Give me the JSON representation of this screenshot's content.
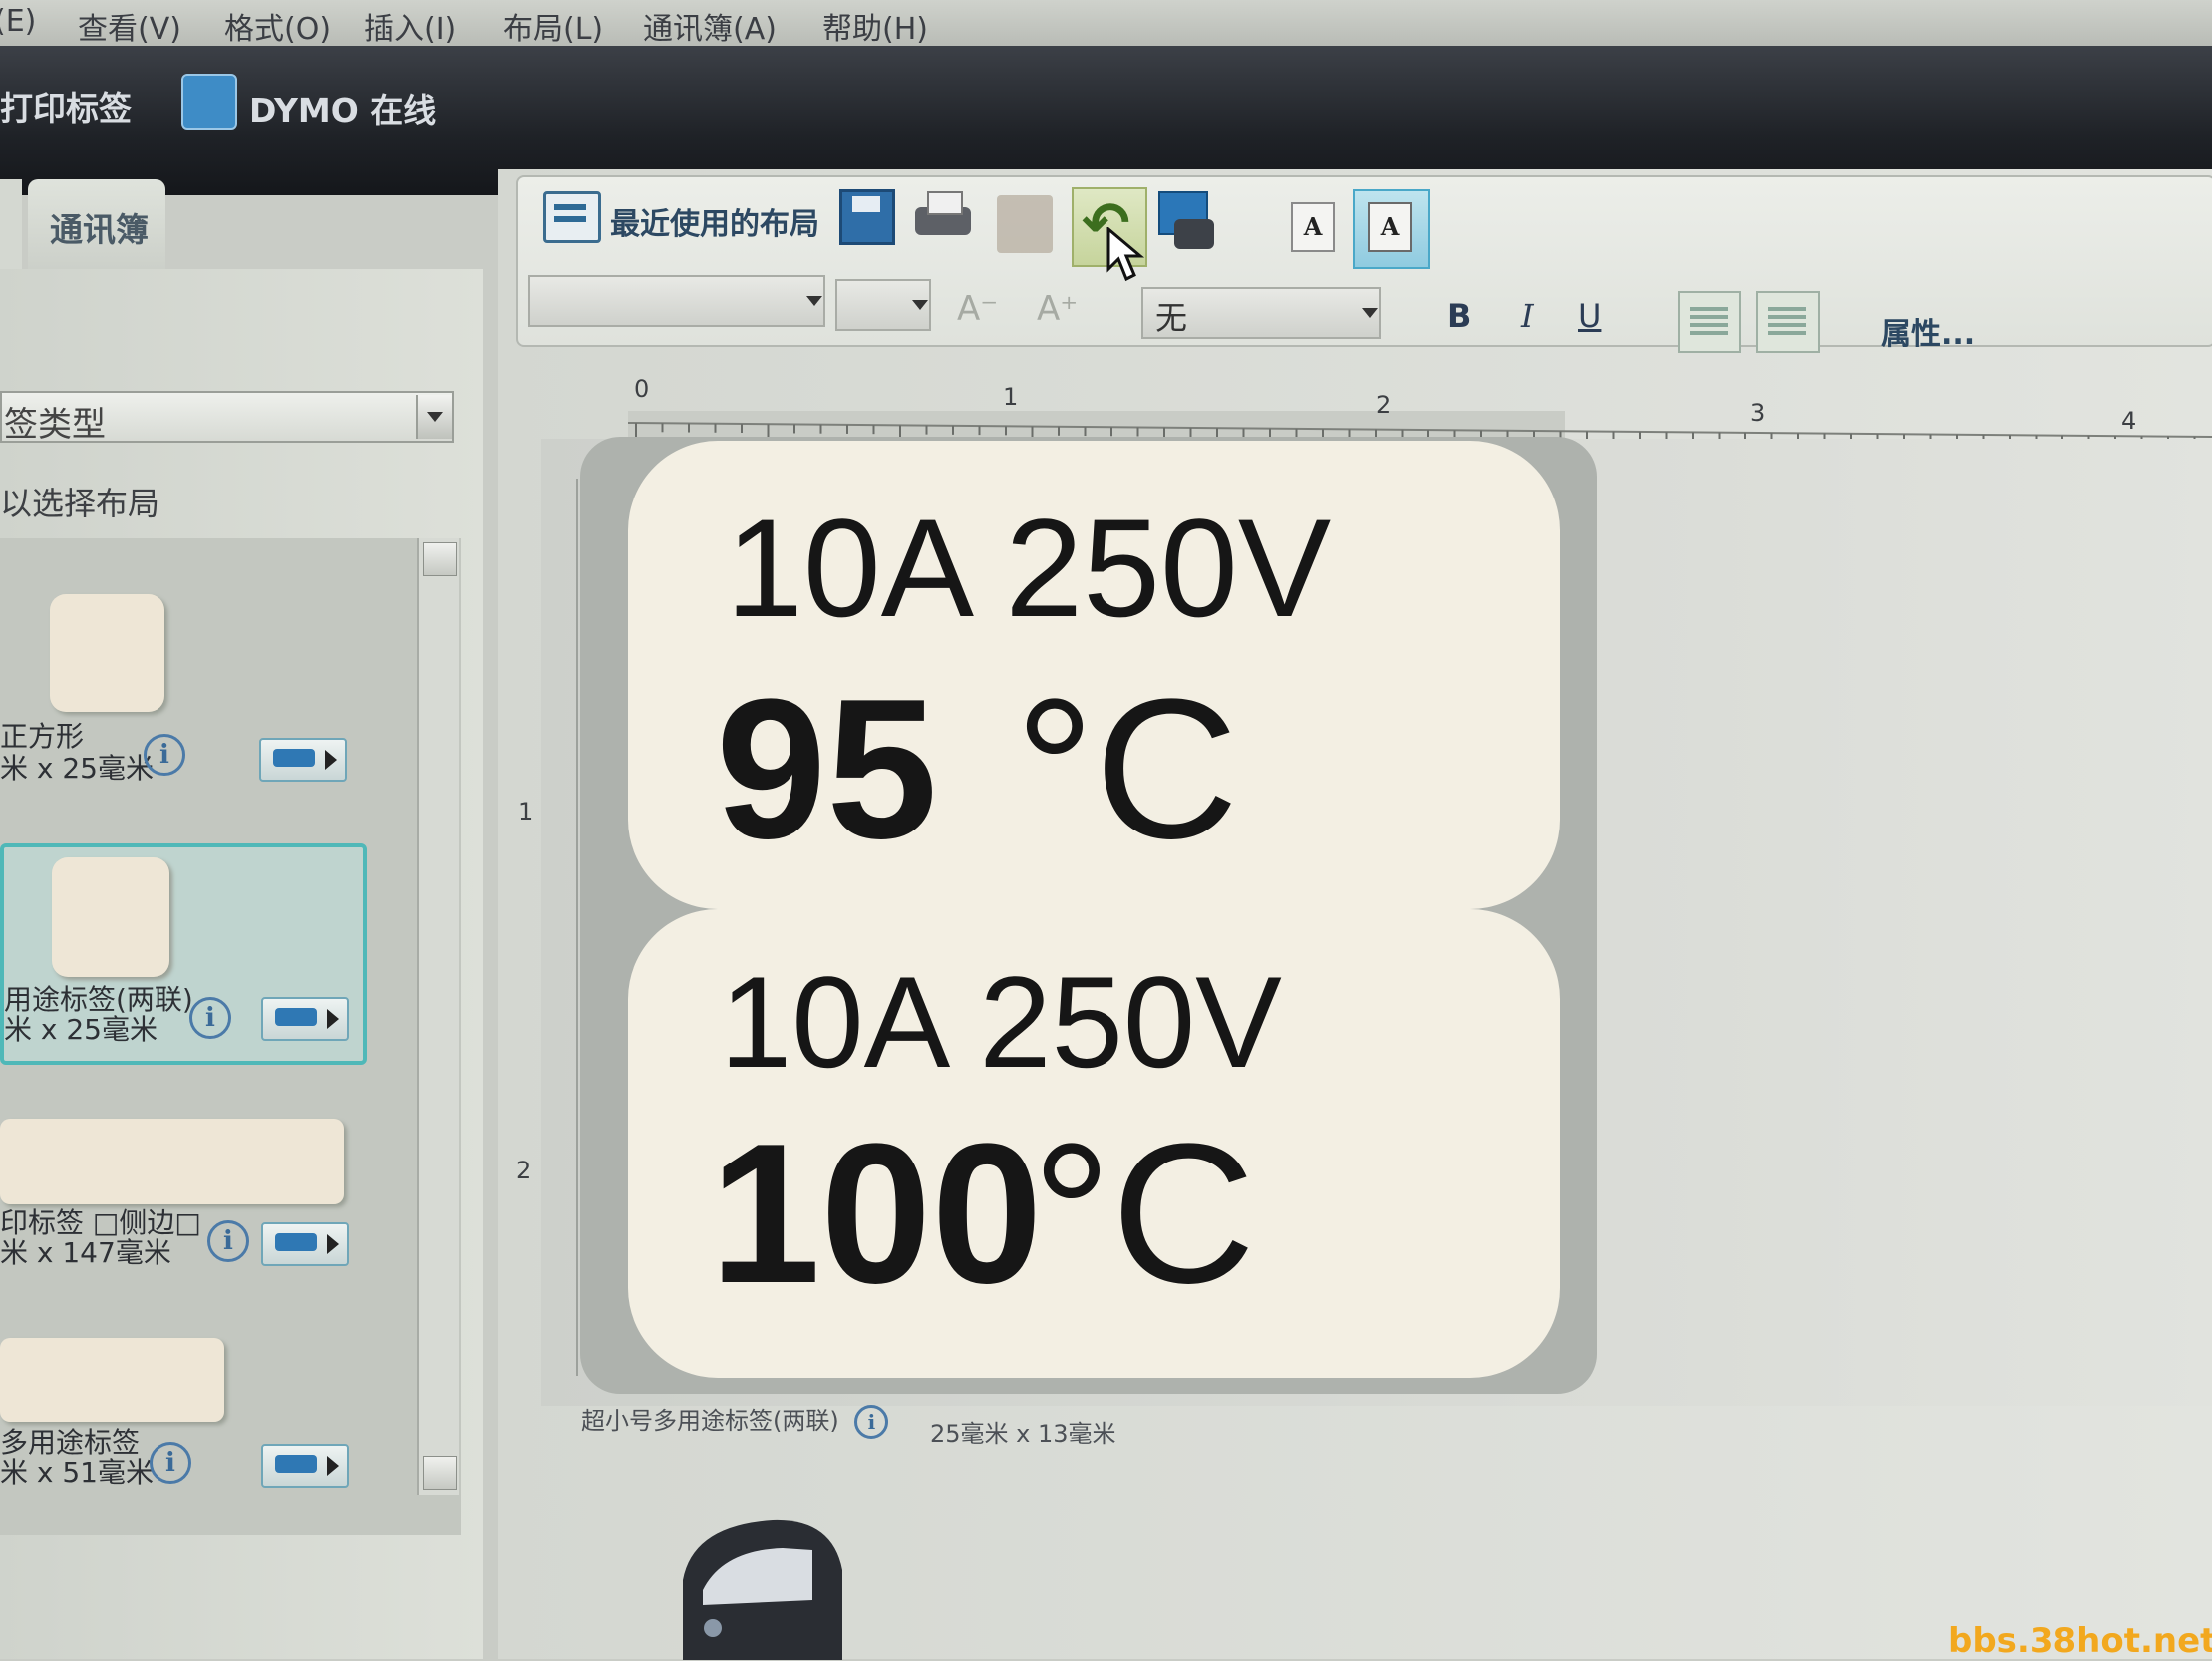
{
  "menu": [
    "(E)",
    "查看(V)",
    "格式(O)",
    "插入(I)",
    "布局(L)",
    "通讯簿(A)",
    "帮助(H)"
  ],
  "app_tabs": {
    "print_labels": "打印标签",
    "dymo_online": "DYMO 在线"
  },
  "left_panel": {
    "address_tab": "通讯簿",
    "label_type_select": "签类型",
    "layout_hint": "以选择布局",
    "items": [
      {
        "name": "正方形",
        "size": "米 x 25毫米"
      },
      {
        "name": "用途标签(两联)",
        "size": "米 x 25毫米"
      },
      {
        "name": "印标签 □侧边□",
        "size": "米 x 147毫米"
      },
      {
        "name": "多用途标签",
        "size": "米 x 51毫米"
      }
    ],
    "info_symbol": "i"
  },
  "toolbar": {
    "recent_layout": "最近使用的布局",
    "undo_symbol": "↶",
    "text_a": "A",
    "font_shrink": "A⁻",
    "font_grow": "A⁺",
    "border": "无",
    "bold": "B",
    "italic": "I",
    "underline": "U",
    "properties": "属性..."
  },
  "ruler": {
    "ticks": [
      "0",
      "1",
      "2",
      "3",
      "4"
    ],
    "side": [
      "1",
      "2"
    ]
  },
  "labels": [
    {
      "rating": "10A 250V",
      "temp_value": "95",
      "temp_unit": "°C"
    },
    {
      "rating": "10A 250V",
      "temp_value": "100",
      "temp_unit": "°C"
    }
  ],
  "canvas_footer": {
    "label_name": "超小号多用途标签(两联)",
    "label_size": "25毫米 x 13毫米"
  },
  "watermark": "bbs.38hot.net",
  "colors": {
    "label_bg": "#f3efe3",
    "selected_border": "#4fb8b8",
    "watermark": "#f2a81e"
  }
}
